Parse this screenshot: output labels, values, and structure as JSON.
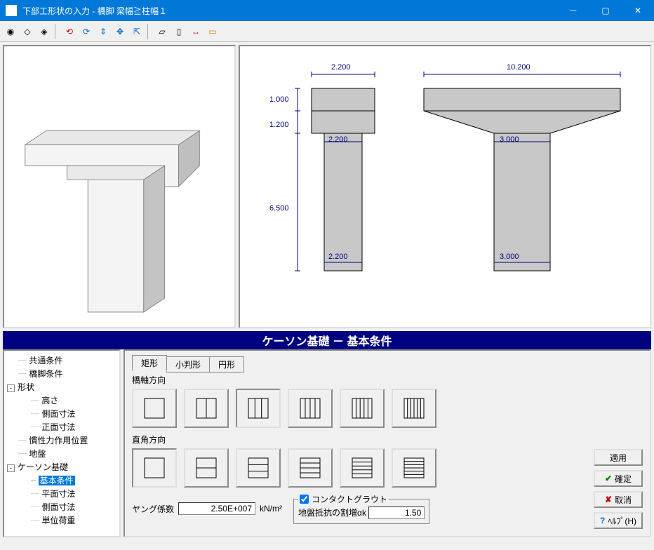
{
  "window": {
    "title": "下部工形状の入力 - 橋脚 梁幅≧柱幅１"
  },
  "toolbar_icons": [
    "view1",
    "view2",
    "view3",
    "cursor",
    "rotate",
    "anchor",
    "pan",
    "fit",
    "front",
    "side",
    "dim",
    "section"
  ],
  "dimensions": {
    "top_left": "2.200",
    "top_right": "10.200",
    "h1": "1.000",
    "h2": "1.200",
    "h3": "6.500",
    "col_left_top": "2.200",
    "col_right_top": "3.000",
    "col_left_bot": "2.200",
    "col_right_bot": "3.000"
  },
  "main_header": "ケーソン基礎 － 基本条件",
  "tree": {
    "items": [
      {
        "label": "共通条件",
        "indent": 1
      },
      {
        "label": "橋脚条件",
        "indent": 1
      },
      {
        "label": "形状",
        "indent": 0,
        "toggle": "-"
      },
      {
        "label": "高さ",
        "indent": 2
      },
      {
        "label": "側面寸法",
        "indent": 2
      },
      {
        "label": "正面寸法",
        "indent": 2
      },
      {
        "label": "慣性力作用位置",
        "indent": 1
      },
      {
        "label": "地盤",
        "indent": 1
      },
      {
        "label": "ケーソン基礎",
        "indent": 0,
        "toggle": "-"
      },
      {
        "label": "基本条件",
        "indent": 2,
        "selected": true
      },
      {
        "label": "平面寸法",
        "indent": 2
      },
      {
        "label": "側面寸法",
        "indent": 2
      },
      {
        "label": "単位荷重",
        "indent": 2
      }
    ]
  },
  "form": {
    "tabs": [
      "矩形",
      "小判形",
      "円形"
    ],
    "active_tab": 0,
    "row1_label": "橋軸方向",
    "row2_label": "直角方向",
    "young_label": "ヤング係数",
    "young_value": "2.50E+007",
    "young_unit": "kN/m²",
    "contact_label": "コンタクトグラウト",
    "contact_checked": true,
    "alpha_label": "地盤抵抗の割増αk",
    "alpha_value": "1.50"
  },
  "buttons": {
    "apply": "適用",
    "ok": "確定",
    "cancel": "取消",
    "help": "ﾍﾙﾌﾟ(H)"
  }
}
